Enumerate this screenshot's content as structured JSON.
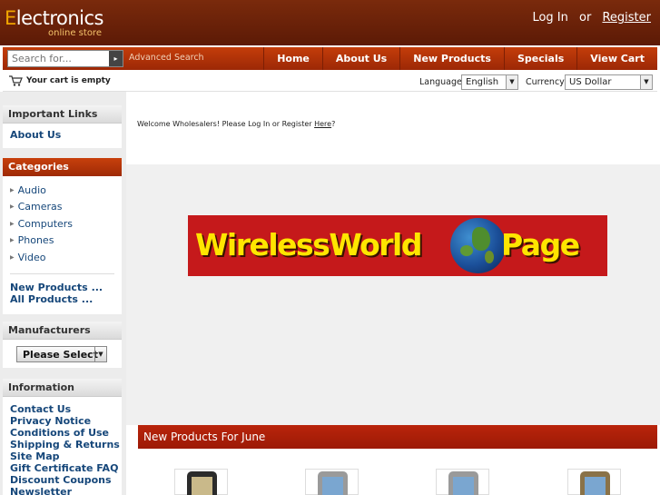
{
  "header": {
    "logo_main_first": "E",
    "logo_main_rest": "lectronics",
    "logo_sub": "online store",
    "login": "Log In",
    "or": "or",
    "register": "Register"
  },
  "navbar": {
    "search_placeholder": "Search for...",
    "search_button": "▸",
    "advanced_search": "Advanced Search",
    "menu": [
      "Home",
      "About Us",
      "New Products",
      "Specials",
      "View Cart"
    ]
  },
  "toolbar": {
    "cart_icon": "cart-icon",
    "cart_text": "Your cart is empty",
    "language_label": "Language:",
    "language_value": "English",
    "currency_label": "Currency:",
    "currency_value": "US Dollar"
  },
  "sidebar": {
    "important_links": {
      "title": "Important Links",
      "items": [
        "About Us"
      ]
    },
    "categories": {
      "title": "Categories",
      "items": [
        "Audio",
        "Cameras",
        "Computers",
        "Phones",
        "Video"
      ],
      "new_products": "New Products ...",
      "all_products": "All Products ..."
    },
    "manufacturers": {
      "title": "Manufacturers",
      "select_value": "Please Select"
    },
    "information": {
      "title": "Information",
      "items": [
        "Contact Us",
        "Privacy Notice",
        "Conditions of Use",
        "Shipping & Returns",
        "Site Map",
        "Gift Certificate FAQ",
        "Discount Coupons",
        "Newsletter"
      ]
    }
  },
  "main": {
    "welcome_prefix": "Welcome Wholesalers! Please Log In or Register ",
    "welcome_link": "Here",
    "welcome_suffix": "?",
    "banner_left": "WirelessWorld",
    "banner_right": "Page",
    "new_products_heading": "New Products For June"
  },
  "colors": {
    "header_bg": "#6b2108",
    "nav_bg": "#b5340a",
    "link_blue": "#16477a",
    "banner_red": "#c5191b",
    "banner_yellow": "#ffe500"
  }
}
